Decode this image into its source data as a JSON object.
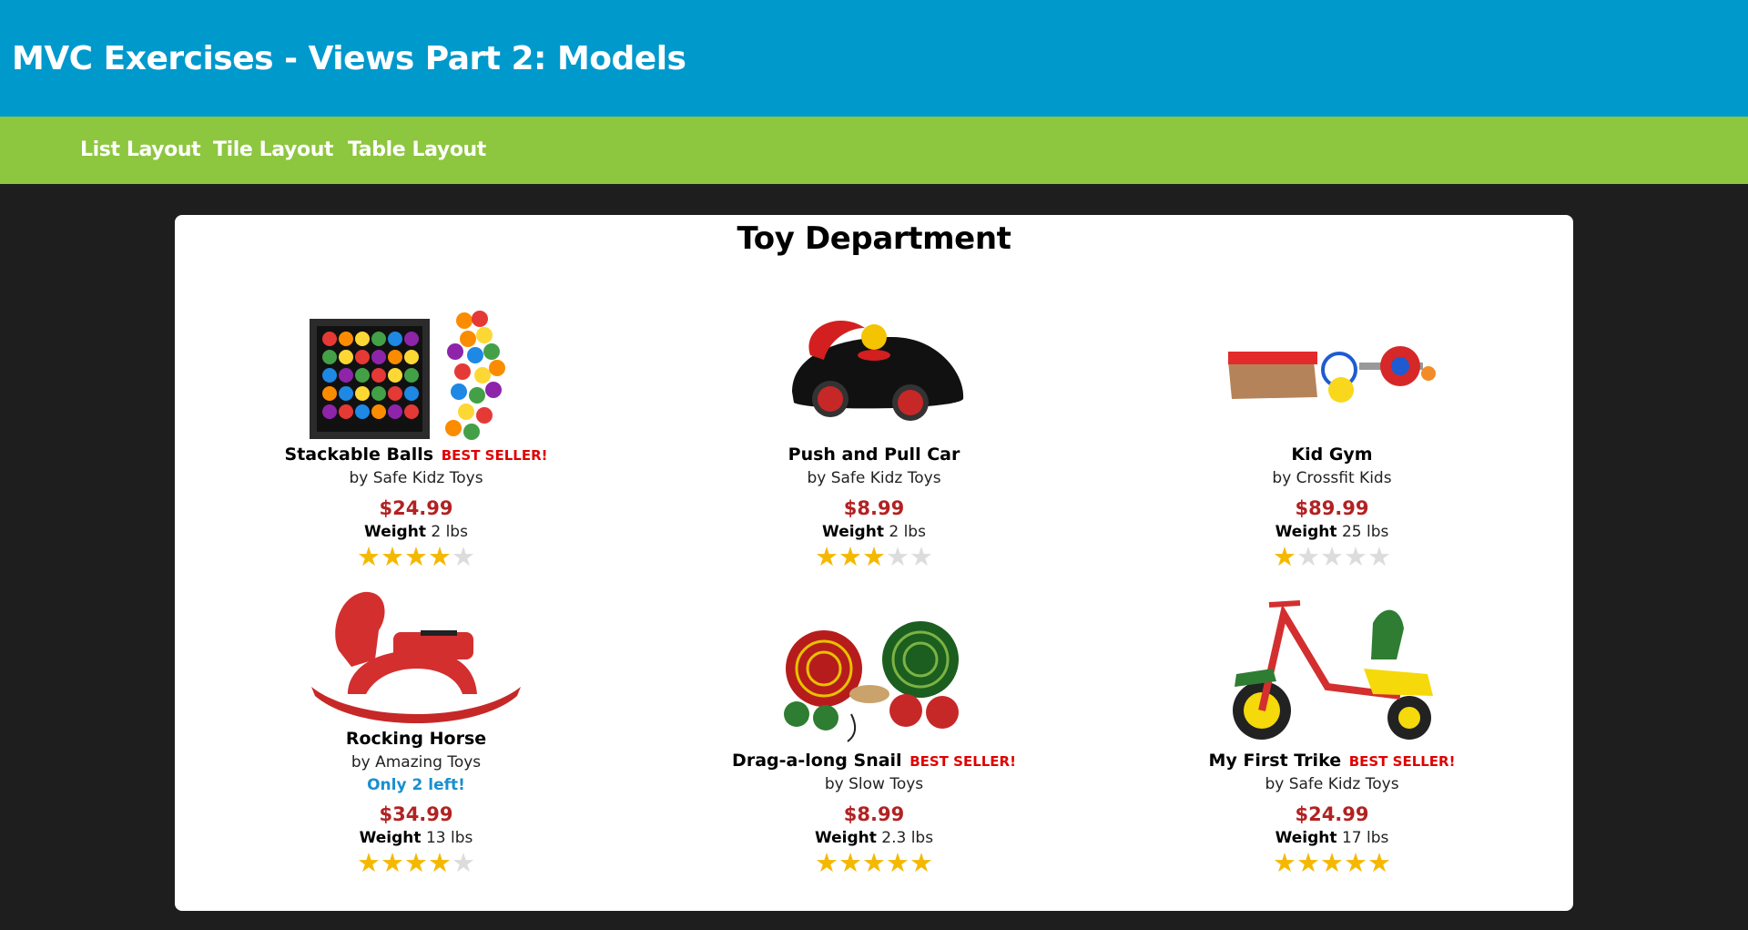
{
  "header": {
    "title": "MVC Exercises - Views Part 2: Models"
  },
  "nav": {
    "items": [
      "List Layout",
      "Tile Layout",
      "Table Layout"
    ]
  },
  "department": {
    "title": "Toy Department"
  },
  "labels": {
    "best_seller": "BEST SELLER!",
    "weight": "Weight"
  },
  "products": [
    {
      "name": "Stackable Balls",
      "best_seller": true,
      "brand": "by Safe Kidz Toys",
      "stock_note": "",
      "price": "$24.99",
      "weight": "2 lbs",
      "rating": 4,
      "image_icon": "stackable-balls-image"
    },
    {
      "name": "Push and Pull Car",
      "best_seller": false,
      "brand": "by Safe Kidz Toys",
      "stock_note": "",
      "price": "$8.99",
      "weight": "2 lbs",
      "rating": 3,
      "image_icon": "push-pull-car-image"
    },
    {
      "name": "Kid Gym",
      "best_seller": false,
      "brand": "by Crossfit Kids",
      "stock_note": "",
      "price": "$89.99",
      "weight": "25 lbs",
      "rating": 1,
      "image_icon": "kid-gym-image"
    },
    {
      "name": "Rocking Horse",
      "best_seller": false,
      "brand": "by Amazing Toys",
      "stock_note": "Only 2 left!",
      "price": "$34.99",
      "weight": "13 lbs",
      "rating": 4,
      "image_icon": "rocking-horse-image"
    },
    {
      "name": "Drag-a-long Snail",
      "best_seller": true,
      "brand": "by Slow Toys",
      "stock_note": "",
      "price": "$8.99",
      "weight": "2.3 lbs",
      "rating": 5,
      "image_icon": "snail-image"
    },
    {
      "name": "My First Trike",
      "best_seller": true,
      "brand": "by Safe Kidz Toys",
      "stock_note": "",
      "price": "$24.99",
      "weight": "17 lbs",
      "rating": 5,
      "image_icon": "trike-image"
    }
  ],
  "colors": {
    "header": "#0099cc",
    "nav": "#8dc63f",
    "background": "#1e1e1e",
    "price": "#b22222",
    "best_seller": "#e00000",
    "stock_note": "#1a8fcf",
    "star": "#f5b800"
  }
}
